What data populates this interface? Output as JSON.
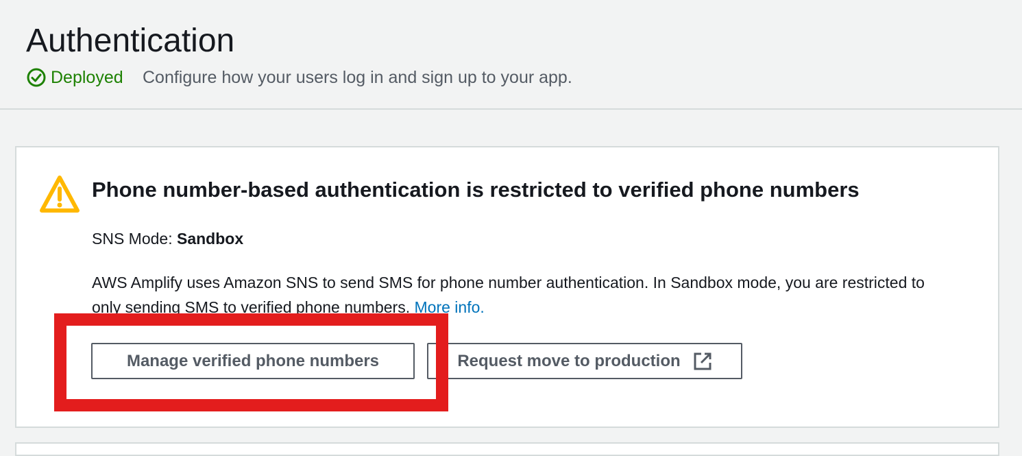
{
  "header": {
    "title": "Authentication",
    "status": "Deployed",
    "subtitle": "Configure how your users log in and sign up to your app."
  },
  "alert": {
    "title": "Phone number-based authentication is restricted to verified phone numbers",
    "sns_mode_label": "SNS Mode:",
    "sns_mode_value": "Sandbox",
    "description": "AWS Amplify uses Amazon SNS to send SMS for phone number authentication. In Sandbox mode, you are restricted to only sending SMS to verified phone numbers.",
    "more_info_link": "More info.",
    "buttons": {
      "manage": "Manage verified phone numbers",
      "request": "Request move to production"
    }
  },
  "icons": {
    "status": "check-circle-icon",
    "alert": "warning-icon",
    "external": "external-link-icon"
  },
  "colors": {
    "status_green": "#1d8102",
    "warning_yellow": "#ffb800",
    "link_blue": "#0073bb",
    "highlight_red": "#e31d1d"
  }
}
